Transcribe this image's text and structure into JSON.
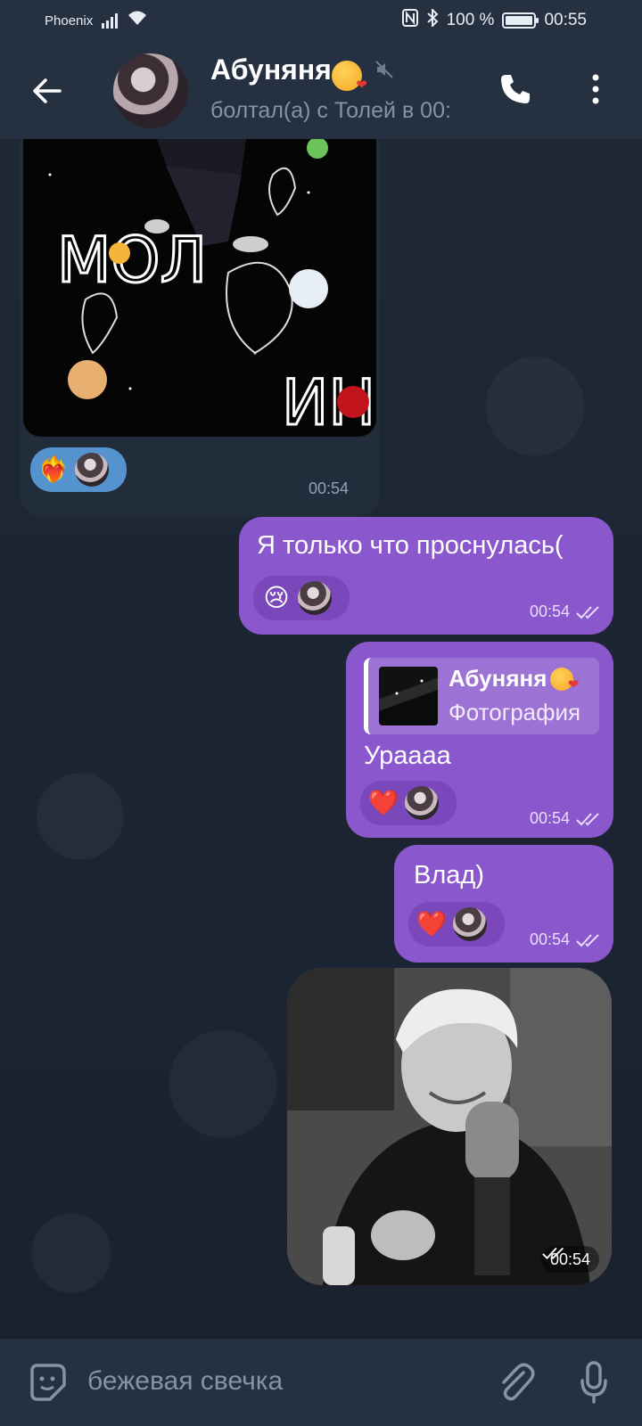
{
  "status_bar": {
    "carrier": "Phoenix",
    "signal": "4G",
    "battery_percent": "100 %",
    "battery_level": 1.0,
    "time": "00:55"
  },
  "header": {
    "title": "Абуняня",
    "title_emoji": "face-blowing-kiss",
    "muted_icon": "speaker-muted-icon",
    "subtitle": "болтал(а) с Толей в 00:"
  },
  "messages": [
    {
      "direction": "incoming",
      "type": "photo",
      "photo_caption_art": "МОЛ ИН",
      "reactions": [
        {
          "emoji": "❤️‍🔥",
          "name": "heart-on-fire"
        },
        {
          "avatar": "reactor-avatar"
        }
      ],
      "time": "00:54"
    },
    {
      "direction": "outgoing",
      "type": "text",
      "text": "Я только что проснулась(",
      "reactions": [
        {
          "emoji": "😢",
          "name": "crying-face"
        },
        {
          "avatar": "reactor-avatar"
        }
      ],
      "time": "00:54",
      "status": "read"
    },
    {
      "direction": "outgoing",
      "type": "text",
      "reply": {
        "name": "Абуняня",
        "kind": "Фотография"
      },
      "text": "Ураааа",
      "reactions": [
        {
          "emoji": "❤️",
          "name": "red-heart"
        },
        {
          "avatar": "reactor-avatar"
        }
      ],
      "time": "00:54",
      "status": "read"
    },
    {
      "direction": "outgoing",
      "type": "text",
      "text": "Влад)",
      "reactions": [
        {
          "emoji": "❤️",
          "name": "red-heart"
        },
        {
          "avatar": "reactor-avatar"
        }
      ],
      "time": "00:54",
      "status": "read"
    },
    {
      "direction": "outgoing",
      "type": "photo",
      "time": "00:54",
      "status": "read"
    }
  ],
  "composer": {
    "placeholder": "бежевая свечка"
  },
  "colors": {
    "header_bg": "#253040",
    "chat_bg": "#1a2330",
    "outgoing_bubble": "#8a57cc",
    "incoming_bubble": "#222d3b",
    "reaction_in": "#5593cf"
  }
}
